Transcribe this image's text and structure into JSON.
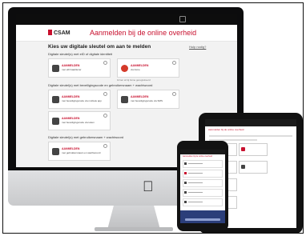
{
  "brand": {
    "logo_text": "CSAM",
    "accent": "#c8102e"
  },
  "imac": {
    "site_title": "Aanmelden bij de online overheid",
    "heading": "Kies uw digitale sleutel om aan te melden",
    "help_link": "Hulp nodig?",
    "sections": [
      {
        "label": "Digitale sleutel(s) met eID of digitale identiteit",
        "cards": [
          {
            "title": "AANMELDEN",
            "subtitle": "met eID kaartlezer",
            "icon": "id-card-icon"
          },
          {
            "title": "AANMELDEN",
            "subtitle": "via itsme",
            "icon": "itsme-icon"
          }
        ],
        "note": "Ik ben al bij itsme geregistreerd"
      },
      {
        "label": "Digitale sleutel(s) met beveiligingscode en gebruikersnaam + wachtwoord",
        "cards": [
          {
            "title": "AANMELDEN",
            "subtitle": "met beveiligingscode via mobiele app",
            "icon": "phone-icon"
          },
          {
            "title": "AANMELDEN",
            "subtitle": "met beveiligingscode via SMS",
            "icon": "sms-icon"
          },
          {
            "title": "AANMELDEN",
            "subtitle": "met beveiligingscode via token",
            "icon": "token-icon"
          }
        ]
      },
      {
        "label": "Digitale sleutel(s) met gebruikersnaam + wachtwoord",
        "cards": [
          {
            "title": "AANMELDEN",
            "subtitle": "met gebruikersnaam en wachtwoord",
            "icon": "password-icon"
          }
        ]
      }
    ]
  },
  "tablet": {
    "title": "Aanmelden bij de online overheid"
  },
  "phone": {
    "title": "Aanmelden bij de online overheid"
  }
}
